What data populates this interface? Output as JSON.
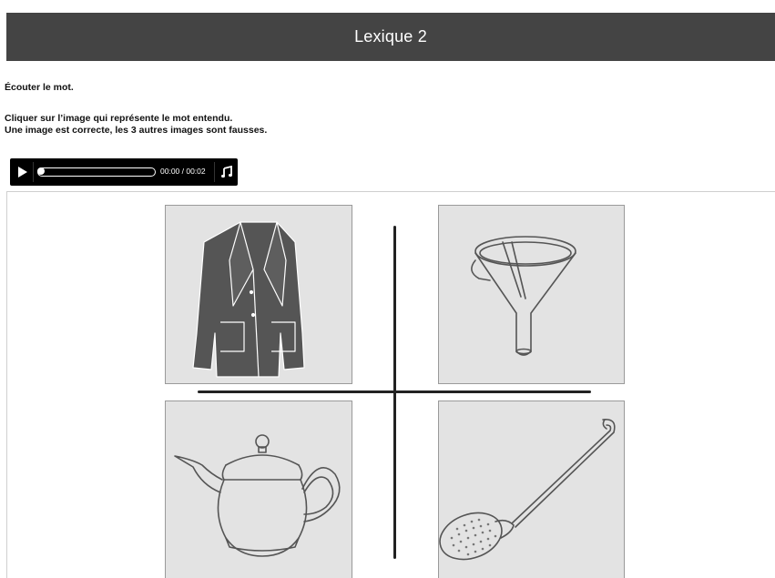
{
  "header": {
    "title": "Lexique 2"
  },
  "instructions": {
    "line1": "Écouter le mot.",
    "line2": "Cliquer sur l’image qui représente le mot entendu.",
    "line3": "Une image est correcte, les 3 autres images sont fausses."
  },
  "audio_player": {
    "time": "00:00 / 00:02",
    "play_icon": "play-icon",
    "note_icon": "music-note-icon",
    "progress": 0
  },
  "choices": [
    {
      "icon": "coat-icon"
    },
    {
      "icon": "funnel-icon"
    },
    {
      "icon": "teapot-icon"
    },
    {
      "icon": "skimmer-icon"
    }
  ],
  "colors": {
    "title_bar": "#444444",
    "card_bg": "#e3e3e3",
    "player_bg": "#000000"
  }
}
